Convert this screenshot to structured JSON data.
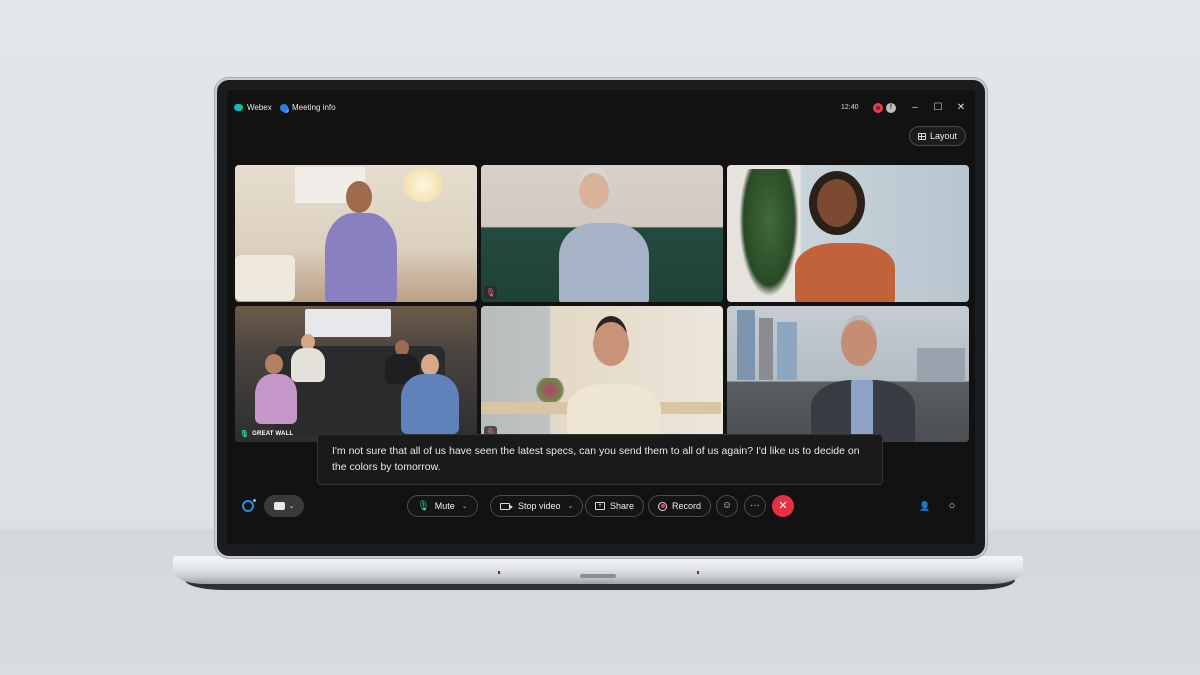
{
  "window": {
    "app_name": "Webex",
    "meeting_info_label": "Meeting info",
    "clock": "12:40",
    "status_badges": [
      {
        "name": "recording",
        "color": "#e5404f"
      },
      {
        "name": "other-app",
        "glyph": "f"
      }
    ],
    "controls": {
      "minimize": "–",
      "maximize": "☐",
      "close": "✕"
    },
    "layout_button_label": "Layout"
  },
  "participants": [
    {
      "scene": "bedroom",
      "muted": false,
      "name": ""
    },
    {
      "scene": "green-sofa",
      "muted": true,
      "name": ""
    },
    {
      "scene": "office-window",
      "muted": false,
      "name": ""
    },
    {
      "scene": "meeting-room",
      "muted": false,
      "name": "GREAT WALL",
      "active_speaker": true
    },
    {
      "scene": "kitchen",
      "muted": true,
      "name": ""
    },
    {
      "scene": "city-skyline",
      "muted": false,
      "name": ""
    }
  ],
  "caption": {
    "text": "I'm not sure that all of us have seen the latest specs, can you send them to all of us again? I'd like us to decide on the colors by tomorrow."
  },
  "toolbar": {
    "mute_label": "Mute",
    "stop_video_label": "Stop video",
    "share_label": "Share",
    "record_label": "Record",
    "reactions_icon": "☺",
    "more_icon": "···",
    "end_icon": "✕",
    "participants_icon": "👤",
    "chat_icon": "○",
    "chevron": "⌄",
    "muted_glyph": "🎙"
  },
  "colors": {
    "accent_green": "#2fd39a",
    "active_speaker_border": "#2fb59d",
    "end_call_red": "#e5303f",
    "ai_blue": "#2d8fe0"
  }
}
